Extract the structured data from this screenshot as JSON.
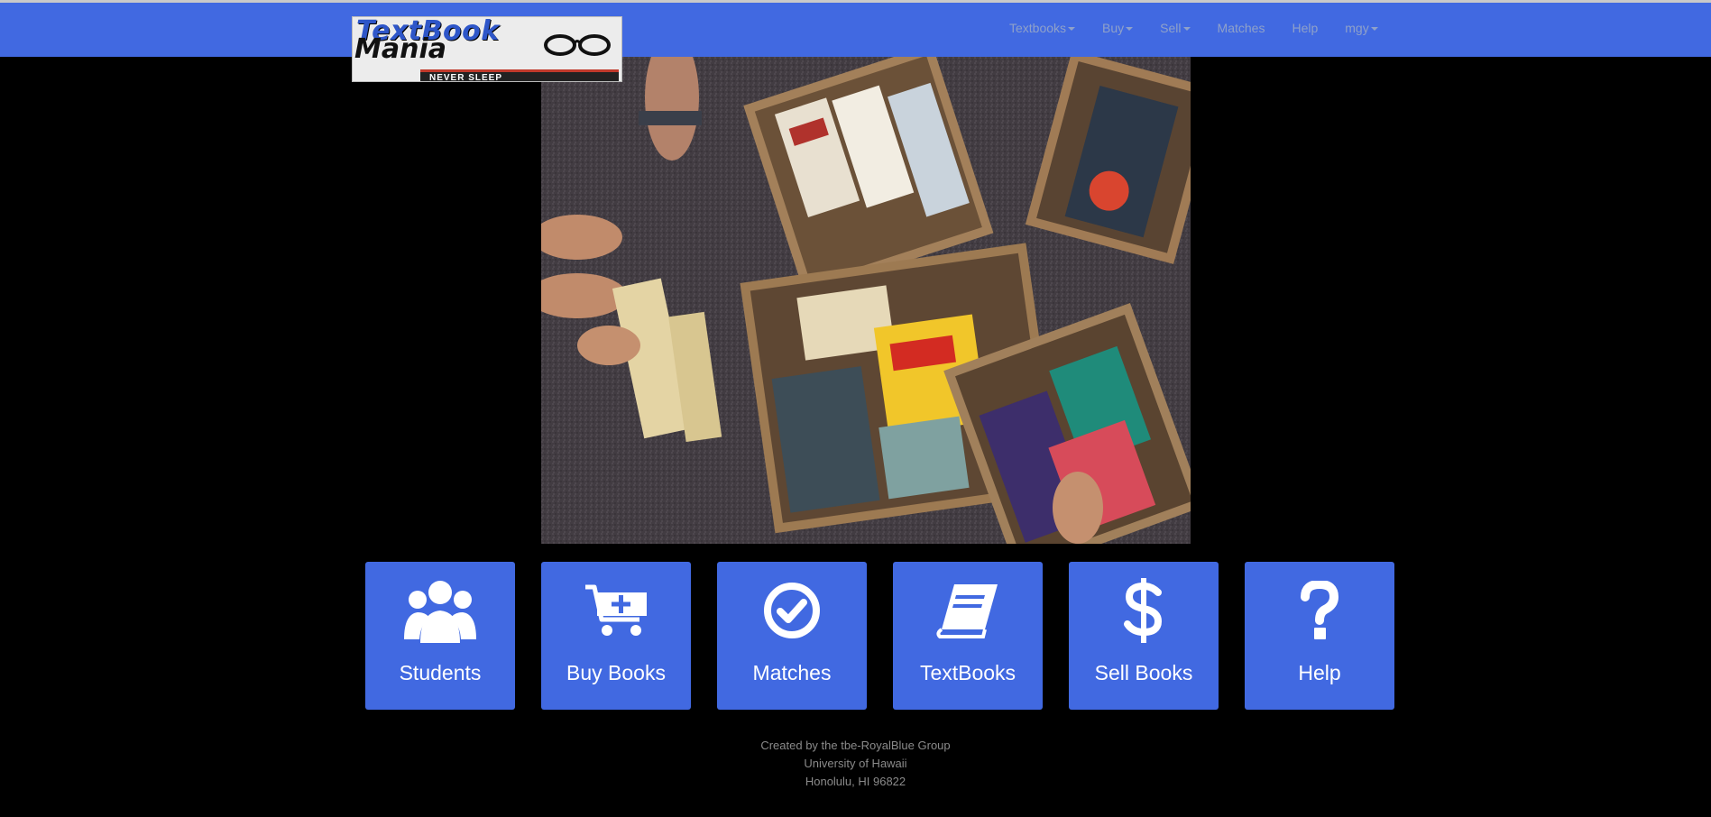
{
  "logo": {
    "line1": "TextBook",
    "line2": "Mania",
    "tagline": "NEVER SLEEP"
  },
  "nav": {
    "items": [
      {
        "label": "Textbooks",
        "dropdown": true
      },
      {
        "label": "Buy",
        "dropdown": true
      },
      {
        "label": "Sell",
        "dropdown": true
      },
      {
        "label": "Matches",
        "dropdown": false
      },
      {
        "label": "Help",
        "dropdown": false
      },
      {
        "label": "mgy",
        "dropdown": true
      }
    ]
  },
  "hero": {
    "subject": "photo of boxes of used books on pavement, viewed from above"
  },
  "tiles": [
    {
      "label": "Students",
      "icon": "users-icon"
    },
    {
      "label": "Buy Books",
      "icon": "cart-plus-icon"
    },
    {
      "label": "Matches",
      "icon": "check-circle-icon"
    },
    {
      "label": "TextBooks",
      "icon": "book-icon"
    },
    {
      "label": "Sell Books",
      "icon": "dollar-icon"
    },
    {
      "label": "Help",
      "icon": "question-icon"
    }
  ],
  "footer": {
    "line1": "Created by the tbe-RoyalBlue Group",
    "line2": "University of Hawaii",
    "line3": "Honolulu, HI 96822"
  },
  "colors": {
    "brand": "#4169e1",
    "background": "#000000",
    "nav_text": "#8fa1c9",
    "footer_text": "#8a8a8a"
  }
}
